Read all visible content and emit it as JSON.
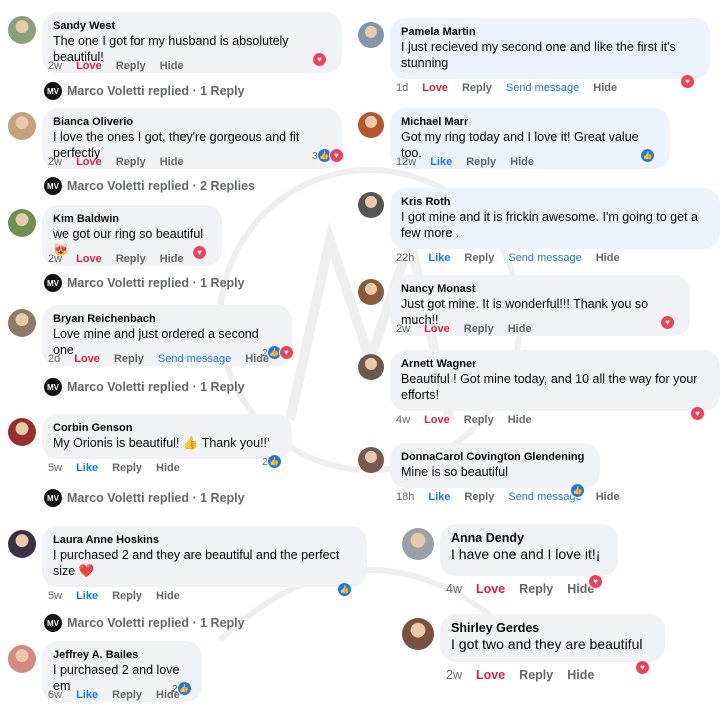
{
  "reply_author": "Marco Voletti",
  "left": [
    {
      "name": "Sandy West",
      "text": "The one I got for my husband is absolutely beautiful!",
      "time": "2w",
      "react": "Love",
      "actions": [
        "Reply",
        "Hide"
      ],
      "count": "",
      "icons": [
        "heart"
      ],
      "reply": "Marco Voletti replied · 1 Reply",
      "av": "#8aa07a"
    },
    {
      "name": "Bianca Oliverio",
      "text": "I love the ones I got, they're gorgeous and fit perfectly",
      "time": "2w",
      "react": "Love",
      "actions": [
        "Reply",
        "Hide"
      ],
      "count": "3",
      "icons": [
        "like",
        "heart"
      ],
      "reply": "Marco Voletti replied · 2 Replies",
      "av": "#c4a27a"
    },
    {
      "name": "Kim Baldwin",
      "text": "we got our ring so beautiful 😻",
      "time": "2w",
      "react": "Love",
      "actions": [
        "Reply",
        "Hide"
      ],
      "count": "",
      "icons": [
        "heart"
      ],
      "reply": "Marco Voletti replied · 1 Reply",
      "av": "#6f8f4e"
    },
    {
      "name": "Bryan Reichenbach",
      "text": "Love mine and just ordered a second one",
      "time": "2d",
      "react": "Love",
      "actions": [
        "Reply",
        "Send message",
        "Hide"
      ],
      "count": "2",
      "icons": [
        "like",
        "heart"
      ],
      "reply": "Marco Voletti replied · 1 Reply",
      "av": "#8c7a66"
    },
    {
      "name": "Corbin Genson",
      "text": "My Orionis is beautiful! 👍 Thank you!!’",
      "time": "5w",
      "react": "Like",
      "actions": [
        "Reply",
        "Hide"
      ],
      "count": "2",
      "icons": [
        "like"
      ],
      "reply": "Marco Voletti replied · 1 Reply",
      "av": "#9a2e2e"
    },
    {
      "name": "Laura Anne Hoskins",
      "text": "I purchased 2 and they are beautiful and the perfect size ❤️",
      "time": "5w",
      "react": "Like",
      "actions": [
        "Reply",
        "Hide"
      ],
      "count": "",
      "icons": [
        "like"
      ],
      "reply": "Marco Voletti replied · 1 Reply",
      "av": "#3a3140"
    },
    {
      "name": "Jeffrey A. Bailes",
      "text": "I purchased 2 and love em",
      "time": "6w",
      "react": "Like",
      "actions": [
        "Reply",
        "Hide"
      ],
      "count": "2",
      "icons": [
        "like"
      ],
      "reply": "",
      "av": "#d48a80"
    }
  ],
  "right": [
    {
      "name": "Pamela Martin",
      "text": "I just recieved my second one and like the first it's stunning",
      "time": "1d",
      "react": "Love",
      "actions": [
        "Reply",
        "Send message",
        "Hide"
      ],
      "count": "",
      "icons": [
        "heart"
      ],
      "av": "#7f98b0"
    },
    {
      "name": "Michael Marr",
      "text": "Got my ring today and I love it! Great value too.",
      "time": "12w",
      "react": "Like",
      "actions": [
        "Reply",
        "Hide"
      ],
      "count": "",
      "icons": [
        "like"
      ],
      "av": "#b5562d"
    },
    {
      "name": "Kris Roth",
      "text": "I got mine and it is frickin awesome. I'm going to get a few more .",
      "time": "22h",
      "react": "Like",
      "actions": [
        "Reply",
        "Send message",
        "Hide"
      ],
      "count": "",
      "icons": [],
      "av": "#555555"
    },
    {
      "name": "Nancy Monast",
      "text": "Just got mine. It is wonderful!!! Thank you so much!!",
      "time": "2w",
      "react": "Love",
      "actions": [
        "Reply",
        "Hide"
      ],
      "count": "",
      "icons": [
        "heart"
      ],
      "av": "#8a5a3c"
    },
    {
      "name": "Arnett Wagner",
      "text": "Beautiful ! Got mine today, and 10 all the way for your efforts!",
      "time": "4w",
      "react": "Love",
      "actions": [
        "Reply",
        "Hide"
      ],
      "count": "",
      "icons": [
        "heart"
      ],
      "av": "#6b5a4a"
    },
    {
      "name": "DonnaCarol Covington Glendening",
      "text": "Mine is so beautiful",
      "time": "18h",
      "react": "Like",
      "actions": [
        "Reply",
        "Send message",
        "Hide"
      ],
      "count": "",
      "icons": [
        "like"
      ],
      "av": "#7a5a50"
    },
    {
      "name": "Anna Dendy",
      "text": "I have one and I love it!¡",
      "time": "4w",
      "react": "Love",
      "actions": [
        "Reply",
        "Hide"
      ],
      "count": "",
      "icons": [
        "heart"
      ],
      "av": "#9aa0a8"
    },
    {
      "name": "Shirley Gerdes",
      "text": "I got two and they are beautiful",
      "time": "2w",
      "react": "Love",
      "actions": [
        "Reply",
        "Hide"
      ],
      "count": "",
      "icons": [
        "heart"
      ],
      "av": "#7a5040"
    }
  ]
}
